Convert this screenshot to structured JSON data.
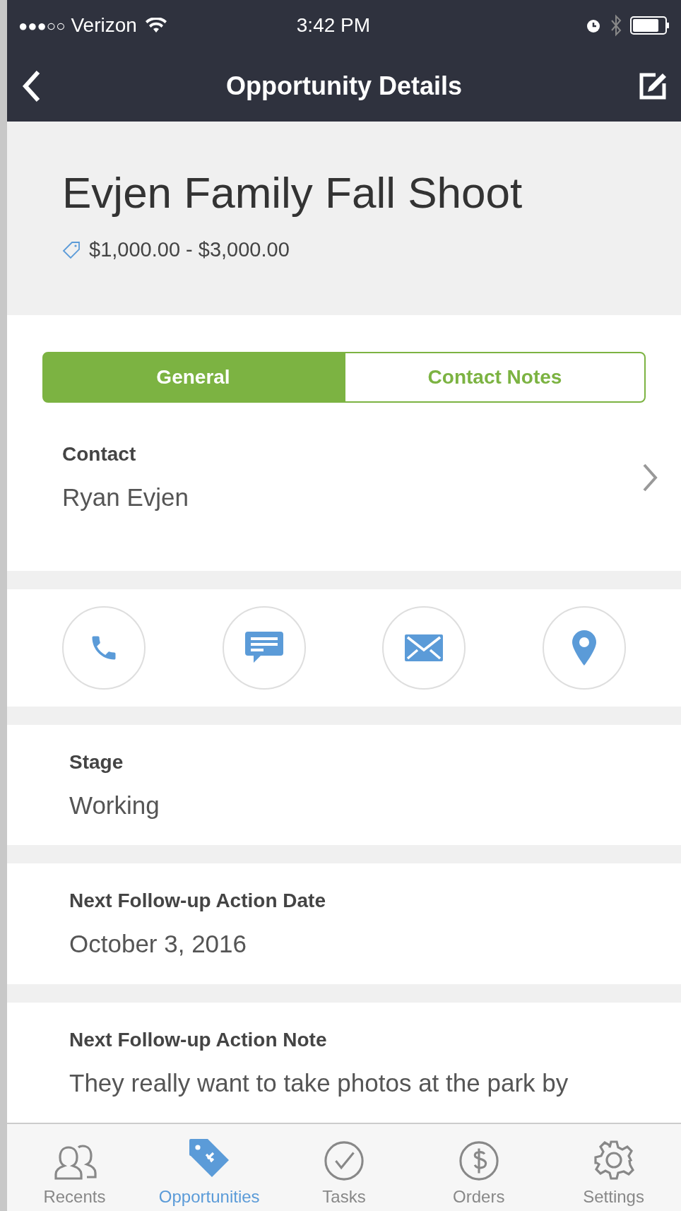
{
  "status_bar": {
    "signal": "●●●○○",
    "carrier": "Verizon",
    "time": "3:42 PM"
  },
  "nav_bar": {
    "title": "Opportunity Details"
  },
  "header": {
    "title": "Evjen Family Fall Shoot",
    "value_range": "$1,000.00 - $3,000.00"
  },
  "tabs": [
    {
      "label": "General",
      "selected": true
    },
    {
      "label": "Contact Notes",
      "selected": false
    }
  ],
  "contact": {
    "label": "Contact",
    "value": "Ryan Evjen"
  },
  "actions": [
    {
      "kind": "phone"
    },
    {
      "kind": "message"
    },
    {
      "kind": "email"
    },
    {
      "kind": "location"
    }
  ],
  "fields": [
    {
      "label": "Stage",
      "value": "Working"
    },
    {
      "label": "Next Follow-up Action Date",
      "value": "October 3, 2016"
    },
    {
      "label": "Next Follow-up Action Note",
      "value": "They really want to take photos at the park by"
    }
  ],
  "tab_bar": [
    {
      "label": "Recents",
      "kind": "people",
      "selected": false
    },
    {
      "label": "Opportunities",
      "kind": "tag",
      "selected": true
    },
    {
      "label": "Tasks",
      "kind": "check",
      "selected": false
    },
    {
      "label": "Orders",
      "kind": "dollar",
      "selected": false
    },
    {
      "label": "Settings",
      "kind": "gear",
      "selected": false
    }
  ]
}
